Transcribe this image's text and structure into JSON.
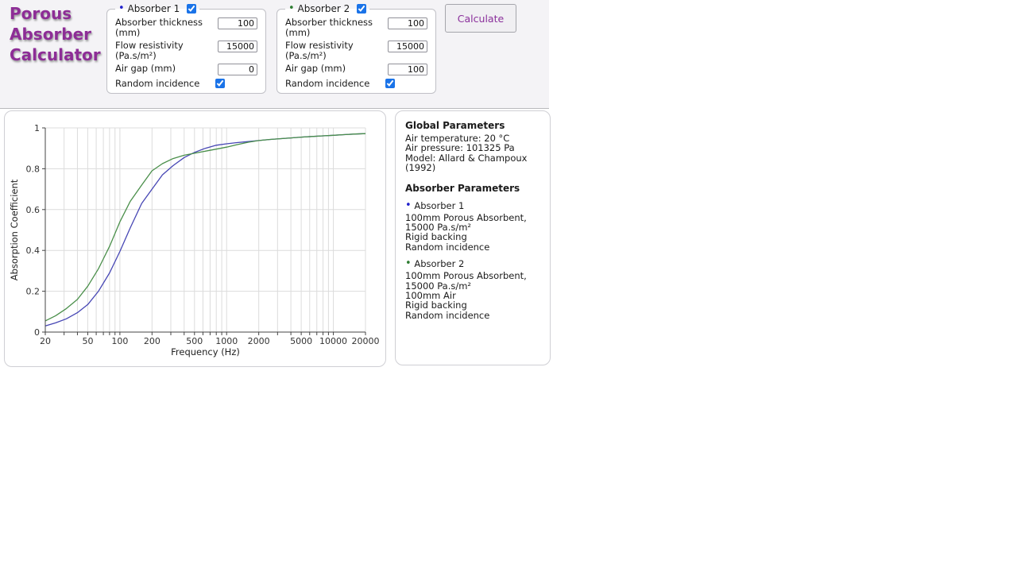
{
  "app": {
    "title_lines": [
      "Porous",
      "Absorber",
      "Calculator"
    ],
    "title_color": "#8d2d96"
  },
  "form": {
    "calculate_label": "Calculate",
    "absorbers": [
      {
        "legend": "Absorber 1",
        "bullet": "•",
        "bullet_color": "#2222cc",
        "enabled": true,
        "fields": [
          {
            "label": "Absorber thickness (mm)",
            "value": "100"
          },
          {
            "label": "Flow resistivity (Pa.s/m²)",
            "value": "15000"
          },
          {
            "label": "Air gap (mm)",
            "value": "0"
          }
        ],
        "checkbox_label": "Random incidence",
        "random_incidence": true
      },
      {
        "legend": "Absorber 2",
        "bullet": "•",
        "bullet_color": "#2e7d32",
        "enabled": true,
        "fields": [
          {
            "label": "Absorber thickness (mm)",
            "value": "100"
          },
          {
            "label": "Flow resistivity (Pa.s/m²)",
            "value": "15000"
          },
          {
            "label": "Air gap (mm)",
            "value": "100"
          }
        ],
        "checkbox_label": "Random incidence",
        "random_incidence": true
      }
    ]
  },
  "params": {
    "global_heading": "Global Parameters",
    "global_lines": [
      "Air temperature: 20 °C",
      "Air pressure: 101325 Pa",
      "Model: Allard & Champoux (1992)"
    ],
    "absorber_heading": "Absorber Parameters",
    "absorbers": [
      {
        "bullet": "•",
        "bullet_color": "#2222cc",
        "name": "Absorber 1",
        "lines": [
          "100mm Porous Absorbent,",
          "15000 Pa.s/m²",
          "Rigid backing",
          "Random incidence"
        ]
      },
      {
        "bullet": "•",
        "bullet_color": "#2e7d32",
        "name": "Absorber 2",
        "lines": [
          "100mm Porous Absorbent,",
          "15000 Pa.s/m²",
          "100mm Air",
          "Rigid backing",
          "Random incidence"
        ]
      }
    ]
  },
  "chart_data": {
    "type": "line",
    "xlabel": "Frequency (Hz)",
    "ylabel": "Absorption Coefficient",
    "x_scale": "log",
    "xlim": [
      20,
      20000
    ],
    "ylim": [
      0,
      1
    ],
    "x_ticks": [
      20,
      50,
      100,
      200,
      500,
      1000,
      2000,
      5000,
      10000,
      20000
    ],
    "y_ticks": [
      0,
      0.2,
      0.4,
      0.6,
      0.8,
      1
    ],
    "grid_x": [
      30,
      40,
      50,
      60,
      70,
      80,
      90,
      100,
      200,
      300,
      400,
      500,
      600,
      700,
      800,
      900,
      1000,
      2000,
      3000,
      4000,
      5000,
      6000,
      7000,
      8000,
      9000,
      10000,
      20000
    ],
    "grid_on": true,
    "legend_position": "none",
    "x": [
      20,
      25,
      31.5,
      40,
      50,
      63,
      80,
      100,
      125,
      160,
      200,
      250,
      315,
      400,
      500,
      630,
      800,
      1000,
      1250,
      1600,
      2000,
      2500,
      3150,
      4000,
      5000,
      6300,
      8000,
      10000,
      12500,
      16000,
      20000
    ],
    "series": [
      {
        "name": "Absorber 1",
        "color": "#4646b4",
        "values": [
          0.03,
          0.045,
          0.065,
          0.095,
          0.135,
          0.2,
          0.29,
          0.395,
          0.51,
          0.63,
          0.7,
          0.77,
          0.815,
          0.855,
          0.88,
          0.9,
          0.915,
          0.922,
          0.928,
          0.933,
          0.938,
          0.943,
          0.947,
          0.951,
          0.955,
          0.958,
          0.961,
          0.964,
          0.967,
          0.97,
          0.972
        ]
      },
      {
        "name": "Absorber 2",
        "color": "#4a8f4a",
        "values": [
          0.055,
          0.08,
          0.115,
          0.16,
          0.225,
          0.31,
          0.42,
          0.54,
          0.64,
          0.72,
          0.79,
          0.825,
          0.85,
          0.866,
          0.876,
          0.886,
          0.896,
          0.906,
          0.918,
          0.93,
          0.938,
          0.943,
          0.947,
          0.951,
          0.955,
          0.958,
          0.961,
          0.964,
          0.967,
          0.97,
          0.972
        ]
      }
    ],
    "axis_color": "#444444",
    "grid_color": "#dcdcdc",
    "tick_text_color": "#333333"
  }
}
